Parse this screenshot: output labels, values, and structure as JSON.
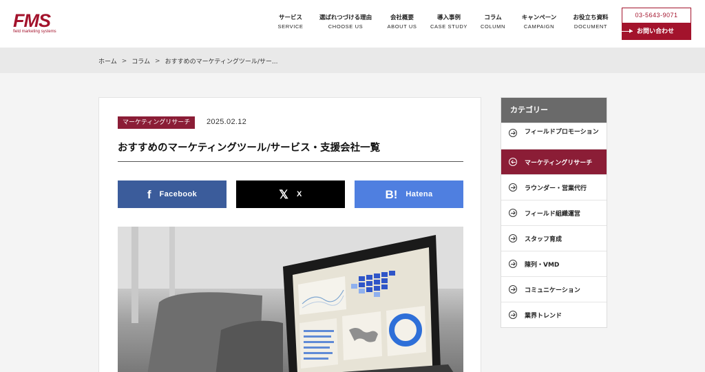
{
  "brand": {
    "logo_mark": "FMS",
    "logo_sub": "field marketing systems"
  },
  "nav": [
    {
      "ja": "サービス",
      "en": "SERVICE"
    },
    {
      "ja": "選ばれつづける理由",
      "en": "CHOOSE US"
    },
    {
      "ja": "会社概要",
      "en": "ABOUT US"
    },
    {
      "ja": "導入事例",
      "en": "CASE STUDY"
    },
    {
      "ja": "コラム",
      "en": "COLUMN"
    },
    {
      "ja": "キャンペーン",
      "en": "CAMPAIGN"
    },
    {
      "ja": "お役立ち資料",
      "en": "DOCUMENT"
    }
  ],
  "header_cta": {
    "phone": "03-5643-9071",
    "contact_label": "お問い合わせ"
  },
  "breadcrumb": {
    "home": "ホーム",
    "column": "コラム",
    "current": "おすすめのマーケティングツール/サー...",
    "separator": ">"
  },
  "article": {
    "category": "マーケティングリサーチ",
    "date": "2025.02.12",
    "title": "おすすめのマーケティングツール/サービス・支援会社一覧"
  },
  "share": {
    "facebook": {
      "icon": "f",
      "label": "Facebook"
    },
    "x": {
      "icon": "𝕏",
      "label": "X"
    },
    "hatena": {
      "icon": "B!",
      "label": "Hatena"
    }
  },
  "sidebar": {
    "heading": "カテゴリー",
    "items": [
      {
        "label": "フィールドプロモーション",
        "active": false
      },
      {
        "label": "マーケティングリサーチ",
        "active": true
      },
      {
        "label": "ラウンダー・営業代行",
        "active": false
      },
      {
        "label": "フィールド組織運営",
        "active": false
      },
      {
        "label": "スタッフ育成",
        "active": false
      },
      {
        "label": "陳列・VMD",
        "active": false
      },
      {
        "label": "コミュニケーション",
        "active": false
      },
      {
        "label": "業界トレンド",
        "active": false
      }
    ]
  },
  "colors": {
    "brand": "#a3132c",
    "category": "#8b1d36",
    "facebook": "#3b5c9b",
    "x": "#000000",
    "hatena": "#4f7fe0"
  }
}
